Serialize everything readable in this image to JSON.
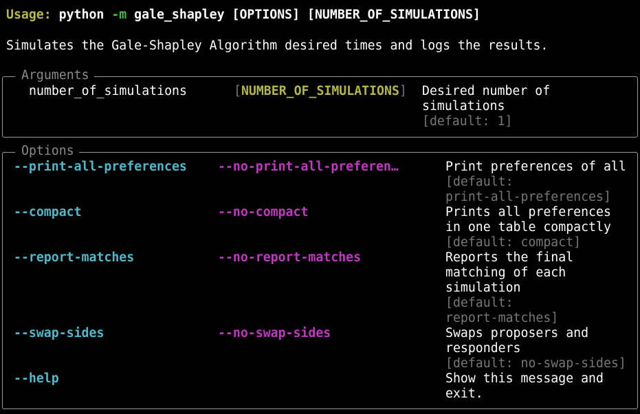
{
  "usage": {
    "label": "Usage:",
    "command": "python",
    "flag": "-m",
    "module": "gale_shapley",
    "rest": "[OPTIONS] [NUMBER_OF_SIMULATIONS]"
  },
  "description": "Simulates the Gale-Shapley Algorithm desired times and logs the results.",
  "arguments": {
    "title": "Arguments",
    "items": [
      {
        "name": "number_of_simulations",
        "bracket_open": "[",
        "type": "NUMBER_OF_SIMULATIONS",
        "bracket_close": "]",
        "help": [
          "Desired number of",
          "simulations"
        ],
        "default": [
          "[default: 1]"
        ]
      }
    ]
  },
  "options": {
    "title": "Options",
    "items": [
      {
        "flag": "--print-all-preferences",
        "negation": "--no-print-all-preferen…",
        "help": [
          "Print preferences of all"
        ],
        "default": [
          "[default:",
          "print-all-preferences]"
        ]
      },
      {
        "flag": "--compact",
        "negation": "--no-compact",
        "help": [
          "Prints all preferences",
          "in one table compactly"
        ],
        "default": [
          "[default: compact]"
        ]
      },
      {
        "flag": "--report-matches",
        "negation": "--no-report-matches",
        "help": [
          "Reports the final",
          "matching of each",
          "simulation"
        ],
        "default": [
          "[default:",
          "report-matches]"
        ]
      },
      {
        "flag": "--swap-sides",
        "negation": "--no-swap-sides",
        "help": [
          "Swaps proposers and",
          "responders"
        ],
        "default": [
          "[default: no-swap-sides]"
        ]
      },
      {
        "flag": "--help",
        "negation": "",
        "help": [
          "Show this message and",
          "exit."
        ],
        "default": []
      }
    ]
  },
  "colors": {
    "background": "#000000",
    "usage_label": "#b7b84a",
    "flag_m": "#3fbf3f",
    "option_flag": "#4fb8c9",
    "option_negation": "#c038c0",
    "metavar": "#b6b648",
    "dim": "#777777",
    "border": "#9a9a9a"
  }
}
